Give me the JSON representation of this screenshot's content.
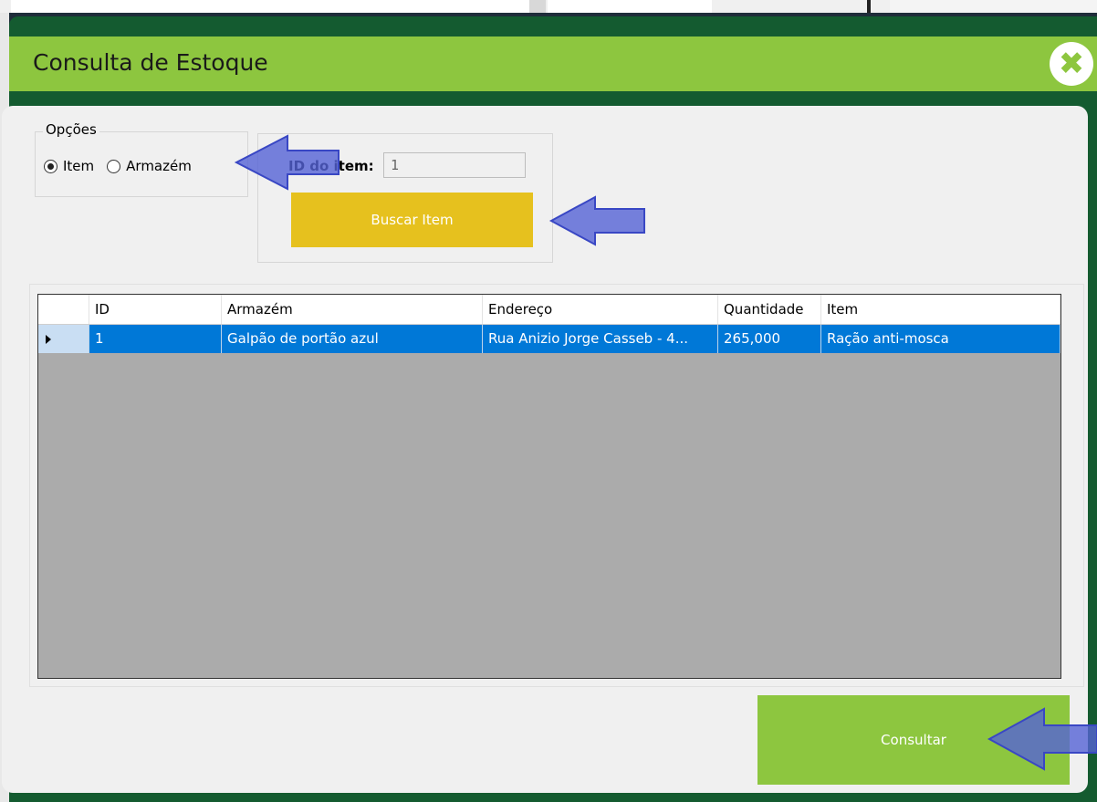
{
  "dialog": {
    "title": "Consulta de Estoque",
    "close_icon": "close-icon",
    "accent_color": "#8dc63f",
    "header_dark_color": "#145b30"
  },
  "options": {
    "legend": "Opções",
    "radios": [
      {
        "label": "Item",
        "checked": true
      },
      {
        "label": "Armazém",
        "checked": false
      }
    ]
  },
  "search": {
    "id_label": "ID do item:",
    "id_value": "1",
    "button_label": "Buscar Item",
    "button_color": "#e6c11e"
  },
  "grid": {
    "columns": [
      "",
      "ID",
      "Armazém",
      "Endereço",
      "Quantidade",
      "Item"
    ],
    "rows": [
      {
        "id": "1",
        "armazem": "Galpão de portão azul",
        "endereco": "Rua Anizio Jorge Casseb - 4...",
        "quantidade": "265,000",
        "item": "Ração anti-mosca",
        "selected": true
      }
    ],
    "selected_color": "#0078d7"
  },
  "footer": {
    "consultar_label": "Consultar"
  },
  "annotations": {
    "arrow_color": "#5563d6"
  }
}
